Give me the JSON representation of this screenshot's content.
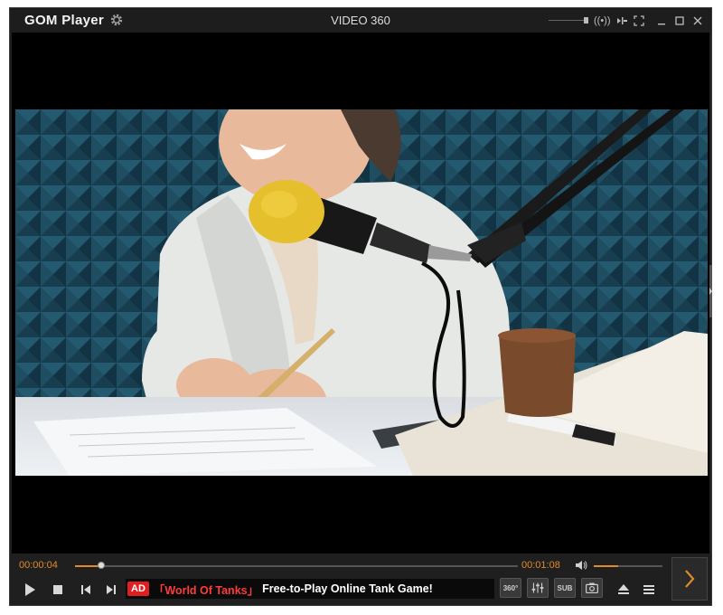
{
  "app": {
    "logo": "GOM Player",
    "title": "VIDEO 360"
  },
  "titlebar": {
    "icons": [
      "settings-icon",
      "audio-surround-icon",
      "output-icon",
      "fullscreen-icon",
      "minimize-icon",
      "maximize-icon",
      "close-icon"
    ]
  },
  "playback": {
    "current_time": "00:00:04",
    "total_time": "00:01:08",
    "progress": 0.06,
    "volume": 0.35
  },
  "ad": {
    "badge": "AD",
    "title": "「World Of Tanks」",
    "text": "Free-to-Play Online Tank Game!"
  },
  "buttons": {
    "vr360": "360°",
    "sub": "SUB"
  },
  "colors": {
    "accent": "#e08b2b",
    "ad_red": "#e02020",
    "background": "#1f1f1f"
  }
}
